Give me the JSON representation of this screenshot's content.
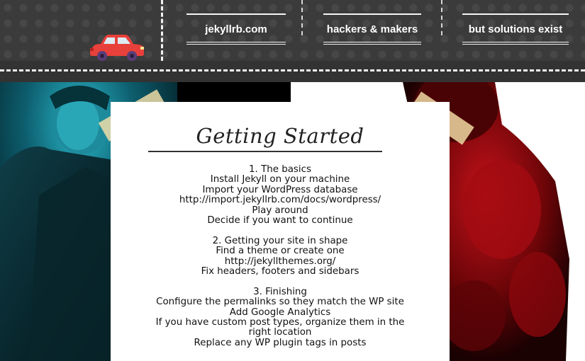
{
  "header": {
    "nav": [
      {
        "label": "jekyllrb.com"
      },
      {
        "label": "hackers & makers"
      },
      {
        "label": "but solutions exist"
      }
    ],
    "icons": {
      "logo": "red-car-icon"
    },
    "colors": {
      "background": "#3b3b3b",
      "accent": "#e8403a"
    }
  },
  "card": {
    "title": "Getting Started",
    "sections": [
      {
        "heading": "1. The basics",
        "items": [
          "Install Jekyll on your machine",
          "Import your WordPress database",
          "http://import.jekyllrb.com/docs/wordpress/",
          "Play around",
          "Decide if you want to continue"
        ]
      },
      {
        "heading": "2. Getting your site in shape",
        "items": [
          "Find a theme or create one",
          "http://jekyllthemes.org/",
          "Fix headers, footers and sidebars"
        ]
      },
      {
        "heading": "3. Finishing",
        "items": [
          "Configure the permalinks so they match the WP site",
          "Add Google Analytics",
          "If you have custom post types, organize them in the right location",
          "Replace any WP plugin tags in posts"
        ]
      }
    ]
  }
}
